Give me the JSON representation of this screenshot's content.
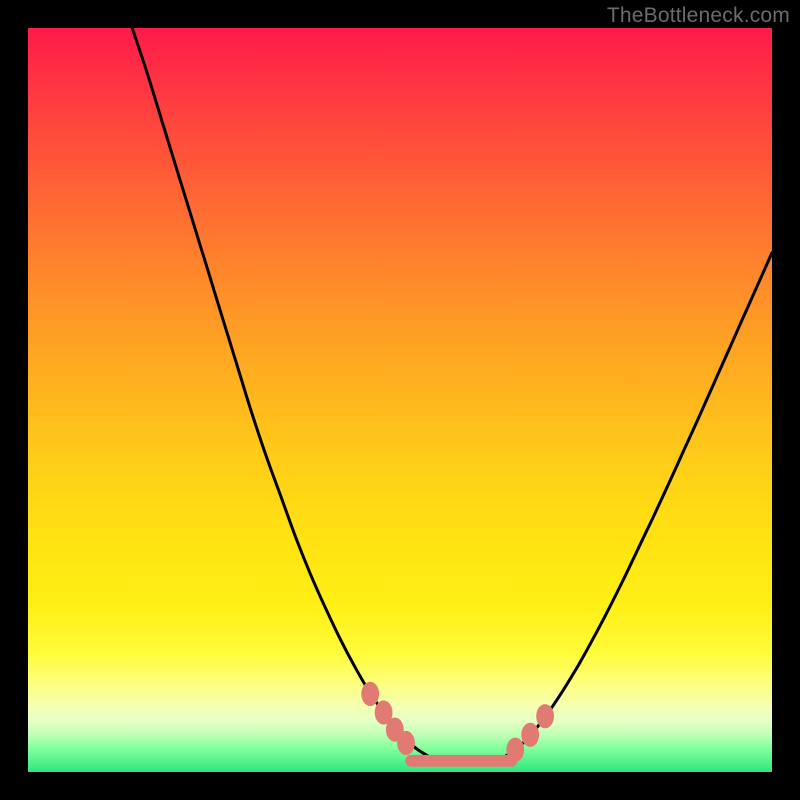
{
  "watermark": "TheBottleneck.com",
  "colors": {
    "frame": "#000000",
    "curve": "#000000",
    "marker_fill": "#e27a74",
    "marker_stroke": "#e27a74"
  },
  "chart_data": {
    "type": "line",
    "title": "",
    "xlabel": "",
    "ylabel": "",
    "xlim": [
      0,
      100
    ],
    "ylim": [
      0,
      100
    ],
    "grid": false,
    "legend": false,
    "series": [
      {
        "name": "left-curve",
        "x": [
          14,
          16,
          18,
          20,
          22,
          24,
          26,
          28,
          30,
          32,
          34,
          36,
          38,
          40,
          42,
          44,
          46,
          48,
          50,
          52,
          54
        ],
        "y": [
          100,
          94,
          87.5,
          81,
          74.5,
          68,
          61.5,
          55,
          48.5,
          42.5,
          37,
          31.5,
          26.5,
          22,
          17.8,
          14,
          10.6,
          7.7,
          5.3,
          3.3,
          2.0
        ]
      },
      {
        "name": "right-curve",
        "x": [
          64,
          66,
          68,
          70,
          72,
          74,
          76,
          78,
          80,
          82,
          84,
          86,
          88,
          90,
          92,
          94,
          96,
          98,
          100
        ],
        "y": [
          2.0,
          3.4,
          5.5,
          8.1,
          11.1,
          14.4,
          18.0,
          21.8,
          25.8,
          30.0,
          34.2,
          38.5,
          42.9,
          47.3,
          51.8,
          56.3,
          60.8,
          65.3,
          69.8
        ]
      },
      {
        "name": "bottom-band",
        "x": [
          54,
          55,
          56,
          57,
          58,
          59,
          60,
          61,
          62,
          63,
          64
        ],
        "y": [
          2.0,
          1.7,
          1.55,
          1.45,
          1.4,
          1.38,
          1.4,
          1.45,
          1.55,
          1.7,
          2.0
        ]
      }
    ],
    "markers": [
      {
        "x": 46.0,
        "y": 10.5,
        "r": 1.2
      },
      {
        "x": 47.8,
        "y": 8.0,
        "r": 1.2
      },
      {
        "x": 49.3,
        "y": 5.7,
        "r": 1.2
      },
      {
        "x": 50.8,
        "y": 3.9,
        "r": 1.2
      },
      {
        "x": 65.5,
        "y": 3.0,
        "r": 1.2
      },
      {
        "x": 67.5,
        "y": 5.0,
        "r": 1.2
      },
      {
        "x": 69.5,
        "y": 7.5,
        "r": 1.2
      }
    ],
    "band": {
      "x_start": 51.5,
      "x_end": 65.0,
      "y": 1.5,
      "thickness": 1.6
    }
  }
}
